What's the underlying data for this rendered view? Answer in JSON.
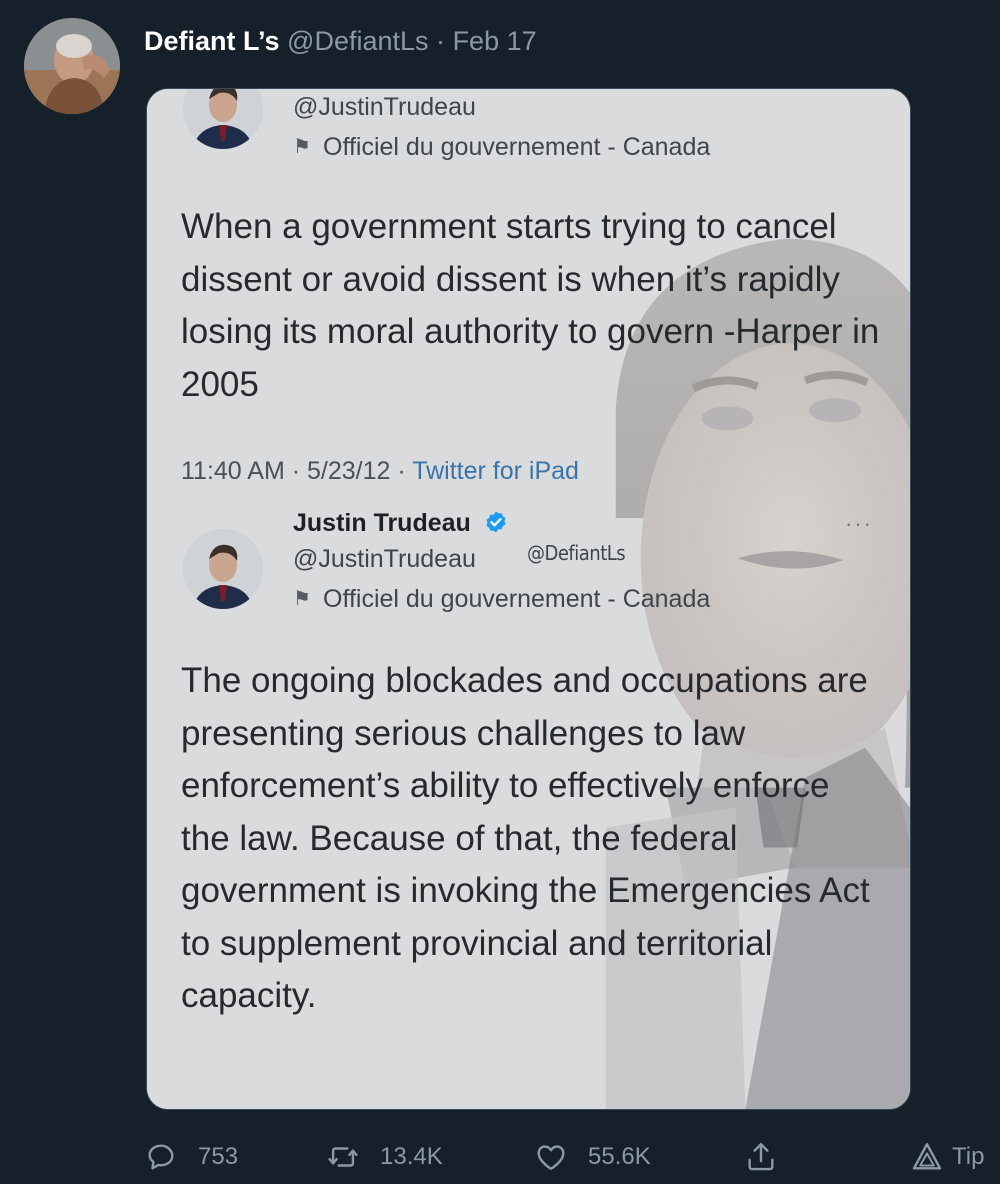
{
  "tweet": {
    "display_name": "Defiant L’s",
    "handle": "@DefiantLs",
    "separator": "·",
    "date": "Feb 17",
    "avatar_icon": "user-avatar"
  },
  "embedded": {
    "quoted": {
      "handle": "@JustinTrudeau",
      "label": "Officiel du gouvernement - Canada",
      "text": "When a government starts trying to cancel dissent or avoid dissent is when it’s rapidly losing its moral authority to govern -Harper in 2005",
      "time": "11:40 AM",
      "meta_separator": "·",
      "date": "5/23/12",
      "source": "Twitter for iPad"
    },
    "reply": {
      "name": "Justin Trudeau",
      "handle": "@JustinTrudeau",
      "watermark": "@DefiantLs",
      "label": "Officiel du gouvernement - Canada",
      "more": "···",
      "text": "The ongoing blockades and occupations are presenting serious challenges to law enforcement’s ability to effectively enforce the law. Because of that, the federal government is invoking the Emergencies Act to supplement provincial and territorial capacity."
    },
    "colors": {
      "verified": "#1d9bf0",
      "source_link": "#3a73a8"
    }
  },
  "actions": {
    "replies": "753",
    "retweets": "13.4K",
    "likes": "55.6K",
    "tip": "Tip"
  }
}
